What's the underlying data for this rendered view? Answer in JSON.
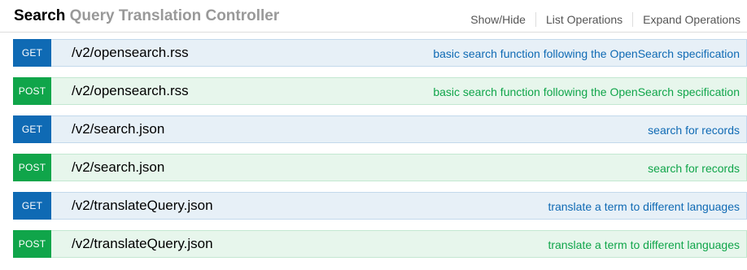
{
  "resource": {
    "title_strong": "Search",
    "title_rest": "Query Translation Controller"
  },
  "header_links": {
    "show_hide": "Show/Hide",
    "list_operations": "List Operations",
    "expand_operations": "Expand Operations"
  },
  "operations": [
    {
      "method": "GET",
      "path": "/v2/opensearch.rss",
      "summary": "basic search function following the OpenSearch specification"
    },
    {
      "method": "POST",
      "path": "/v2/opensearch.rss",
      "summary": "basic search function following the OpenSearch specification"
    },
    {
      "method": "GET",
      "path": "/v2/search.json",
      "summary": "search for records"
    },
    {
      "method": "POST",
      "path": "/v2/search.json",
      "summary": "search for records"
    },
    {
      "method": "GET",
      "path": "/v2/translateQuery.json",
      "summary": "translate a term to different languages"
    },
    {
      "method": "POST",
      "path": "/v2/translateQuery.json",
      "summary": "translate a term to different languages"
    }
  ],
  "colors": {
    "get": "#0f6ab4",
    "post": "#10a54a",
    "get_bg": "#e7f0f7",
    "post_bg": "#e7f6ec",
    "title_muted": "#999999"
  }
}
